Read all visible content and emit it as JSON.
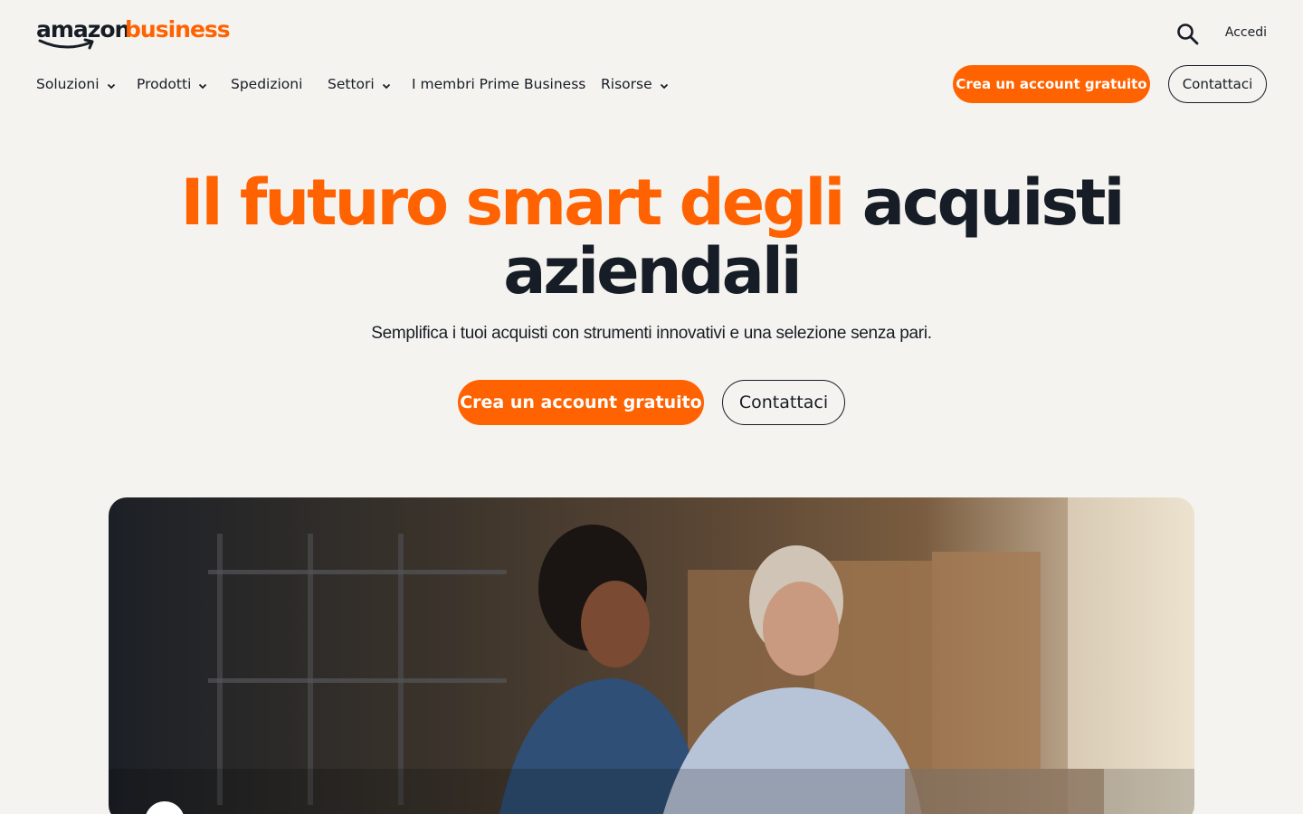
{
  "header": {
    "logo_amazon": "amazon",
    "logo_business": "business",
    "search_icon": "search-icon",
    "signin_label": "Accedi",
    "cta_primary": "Crea un account gratuito",
    "cta_secondary": "Contattaci"
  },
  "nav": {
    "items": [
      {
        "label": "Soluzioni",
        "has_dropdown": true
      },
      {
        "label": "Prodotti",
        "has_dropdown": true
      },
      {
        "label": "Spedizioni",
        "has_dropdown": false
      },
      {
        "label": "Settori",
        "has_dropdown": true
      },
      {
        "label": "I membri Prime Business",
        "has_dropdown": false
      },
      {
        "label": "Risorse",
        "has_dropdown": true
      }
    ]
  },
  "hero": {
    "title_orange": "Il futuro smart degli",
    "title_dark_1": "acquisti",
    "title_dark_2": "aziendali",
    "subtitle": "Semplifica i tuoi acquisti con strumenti innovativi e una selezione senza pari.",
    "cta_primary": "Crea un account gratuito",
    "cta_secondary": "Contattaci",
    "media_icon": "play-icon"
  },
  "colors": {
    "accent": "#ff6200",
    "text": "#161d26",
    "background": "#f5f3ef"
  }
}
